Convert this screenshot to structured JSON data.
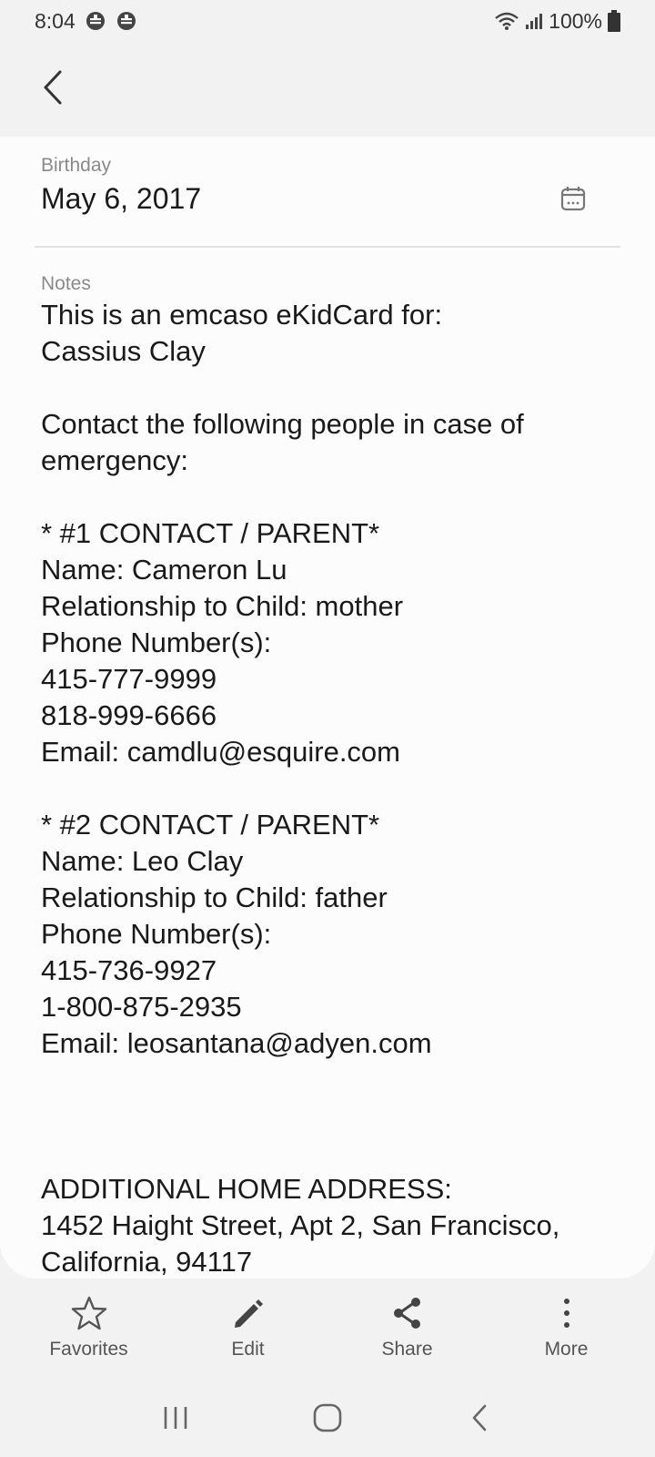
{
  "status_bar": {
    "time": "8:04",
    "battery": "100%",
    "icons": [
      "notification-icon",
      "notification-icon",
      "wifi-icon",
      "signal-icon",
      "battery-icon"
    ]
  },
  "app_bar": {
    "back_icon": "back-icon"
  },
  "birthday": {
    "label": "Birthday",
    "value": "May 6, 2017",
    "icon": "calendar-icon"
  },
  "notes": {
    "label": "Notes",
    "text": "This is an emcaso eKidCard for:\nCassius Clay\n\nContact the following people in case of emergency:\n\n* #1 CONTACT / PARENT*\nName: Cameron Lu\nRelationship to Child: mother\nPhone Number(s):\n415-777-9999\n818-999-6666\nEmail: camdlu@esquire.com\n\n* #2 CONTACT / PARENT*\nName: Leo Clay\nRelationship to Child: father\nPhone Number(s):\n415-736-9927\n1-800-875-2935\nEmail: leosantana@adyen.com\n\n\n\nADDITIONAL HOME ADDRESS:\n1452 Haight Street, Apt 2, San Francisco, California, 94117"
  },
  "actions": [
    {
      "label": "Favorites",
      "icon": "star-icon"
    },
    {
      "label": "Edit",
      "icon": "pencil-icon"
    },
    {
      "label": "Share",
      "icon": "share-icon"
    },
    {
      "label": "More",
      "icon": "more-vertical-icon"
    }
  ],
  "nav_bar": {
    "icons": [
      "recent-apps-icon",
      "home-icon",
      "nav-back-icon"
    ]
  },
  "colors": {
    "background": "#f2f2f2",
    "card": "#fcfcfc",
    "text": "#1a1a1a",
    "label": "#8a8a8a"
  }
}
